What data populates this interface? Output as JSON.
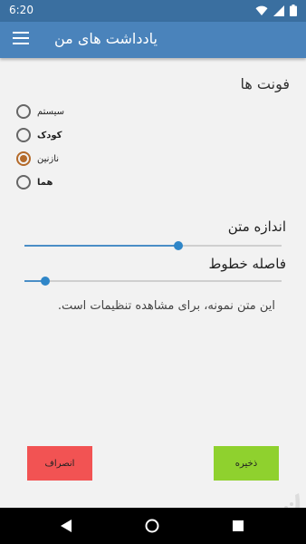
{
  "status_bar": {
    "time": "6:20"
  },
  "app_bar": {
    "title": "یادداشت های من"
  },
  "fonts_section": {
    "title": "فونت ها",
    "options": [
      {
        "label": "سیستم",
        "checked": false
      },
      {
        "label": "کودک",
        "checked": false
      },
      {
        "label": "نازنین",
        "checked": true
      },
      {
        "label": "هما",
        "checked": false
      }
    ]
  },
  "text_size": {
    "label": "اندازه متن",
    "value_fraction": 0.6
  },
  "line_spacing": {
    "label": "فاصله خطوط",
    "value_fraction": 0.08
  },
  "sample_text": "این متن نمونه، برای مشاهده تنظیمات است.",
  "buttons": {
    "cancel": "انصراف",
    "save": "ذخیره"
  },
  "colors": {
    "status_bar": "#3a6fa0",
    "app_bar": "#4a83bb",
    "radio_accent": "#b46a2a",
    "slider_accent": "#2f86c8",
    "cancel_button": "#f25353",
    "save_button": "#8fd12e"
  },
  "icons": [
    "wifi-icon",
    "signal-icon",
    "battery-icon",
    "menu-icon",
    "back-icon",
    "home-icon",
    "recent-apps-icon"
  ]
}
